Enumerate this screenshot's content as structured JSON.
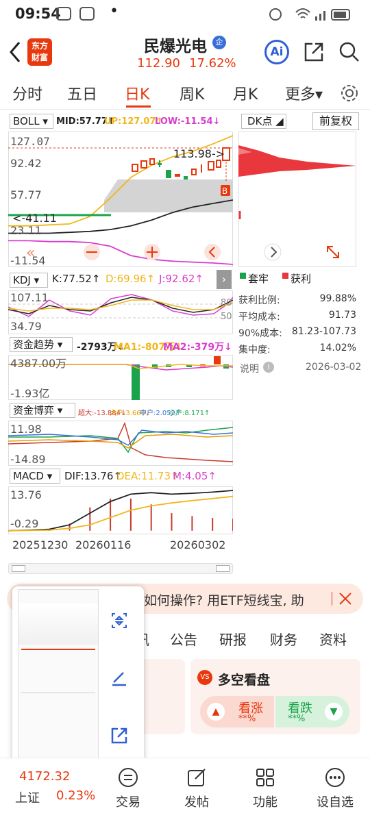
{
  "status": {
    "time": "09:54",
    "dot": "•"
  },
  "header": {
    "logo_line1": "东方",
    "logo_line2": "财富",
    "stock_name": "民爆光电",
    "badge": "企",
    "price": "112.90",
    "change": "17.62%",
    "ai_label": "Ai"
  },
  "tabs": [
    {
      "label": "分时"
    },
    {
      "label": "五日"
    },
    {
      "label": "日K"
    },
    {
      "label": "周K"
    },
    {
      "label": "月K"
    },
    {
      "label": "更多▾"
    }
  ],
  "boll": {
    "name": "BOLL",
    "mid": "MID:57.77↑",
    "up": "UP:127.07↑",
    "low": "LOW:-11.54↓",
    "axis_top": "127.07",
    "axis_2": "92.42",
    "axis_3": "57.77",
    "axis_4": "23.11",
    "axis_bottom": "-11.54",
    "high_mark": "113.98->",
    "low_mark": "<-41.11",
    "b_marker": "B"
  },
  "dk": {
    "name": "DK点",
    "fuquan": "前复权",
    "legend_trapped": "套牢",
    "legend_profit": "获利",
    "stats": [
      {
        "k": "获利比例:",
        "v": "99.88%"
      },
      {
        "k": "平均成本:",
        "v": "91.73"
      },
      {
        "k": "90%成本:",
        "v": "81.23-107.73"
      },
      {
        "k": "集中度:",
        "v": "14.02%"
      }
    ],
    "explain": "说明",
    "date": "2026-03-02"
  },
  "kdj": {
    "name": "KDJ",
    "k": "K:77.52↑",
    "d": "D:69.96↑",
    "j": "J:92.62↑",
    "axis_top": "107.11",
    "axis_bottom": "34.79",
    "right_top": "80",
    "right_bottom": "50"
  },
  "fund": {
    "name": "资金趋势",
    "v": "-2793万↓",
    "ma1": "MA1:-807万↓",
    "ma2": "MA2:-379万↓",
    "axis_top": "4387.00万",
    "axis_bottom": "-1.93亿"
  },
  "game": {
    "name": "资金博弈",
    "super": "超大:-13.884↓",
    "big": "大户:3.660↓",
    "mid": "中户:2.052↑",
    "small": "小户:8.171↑",
    "axis_top": "11.98",
    "axis_bottom": "-14.89"
  },
  "macd": {
    "name": "MACD",
    "dif": "DIF:13.76↑",
    "dea": "DEA:11.73↑",
    "m": "M:4.05↑",
    "axis_top": "13.76",
    "axis_bottom": "-0.29"
  },
  "dates": {
    "d1": "20251230",
    "d2": "20260116",
    "d3": "20260302"
  },
  "banner": {
    "text": "如何操作? 用ETF短线宝, 助"
  },
  "segments": [
    {
      "label": "讯"
    },
    {
      "label": "公告"
    },
    {
      "label": "研报"
    },
    {
      "label": "财务"
    },
    {
      "label": "资料"
    }
  ],
  "vote": {
    "title": "多空看盘",
    "up_label": "看涨",
    "up_pct": "**%",
    "down_label": "看跌",
    "down_pct": "**%"
  },
  "bottom": {
    "index_value": "4172.32",
    "index_name": "上证",
    "index_change": "0.23%",
    "items": [
      {
        "label": "交易"
      },
      {
        "label": "发帖"
      },
      {
        "label": "功能"
      },
      {
        "label": "设自选"
      }
    ]
  },
  "colors": {
    "up": "#e8380d",
    "down": "#1aa34a",
    "yellow": "#f2b61c",
    "pink": "#d93ccf"
  },
  "chart_data": [
    {
      "type": "line",
      "title": "BOLL",
      "ylim": [
        -11.54,
        127.07
      ],
      "series": [
        {
          "name": "MID",
          "values": [
            22,
            22,
            22,
            23,
            24,
            26,
            30,
            36,
            44,
            50,
            54,
            57.77
          ]
        },
        {
          "name": "UP",
          "values": [
            30,
            30,
            31,
            32,
            40,
            60,
            82,
            95,
            104,
            110,
            118,
            127.07
          ]
        },
        {
          "name": "LOW",
          "values": [
            14,
            14,
            13,
            13,
            12,
            8,
            -2,
            -6,
            -8,
            -9,
            -10,
            -11.54
          ]
        }
      ]
    },
    {
      "type": "line",
      "title": "MACD",
      "ylim": [
        -0.29,
        13.76
      ],
      "series": [
        {
          "name": "DIF",
          "values": [
            0,
            0.2,
            0.5,
            2,
            6,
            10,
            12.5,
            13,
            12.5,
            12.8,
            13.2,
            13.76
          ]
        },
        {
          "name": "DEA",
          "values": [
            0,
            0.1,
            0.2,
            0.8,
            2,
            4.5,
            7,
            8.5,
            9.5,
            10.3,
            11,
            11.73
          ]
        }
      ]
    }
  ]
}
